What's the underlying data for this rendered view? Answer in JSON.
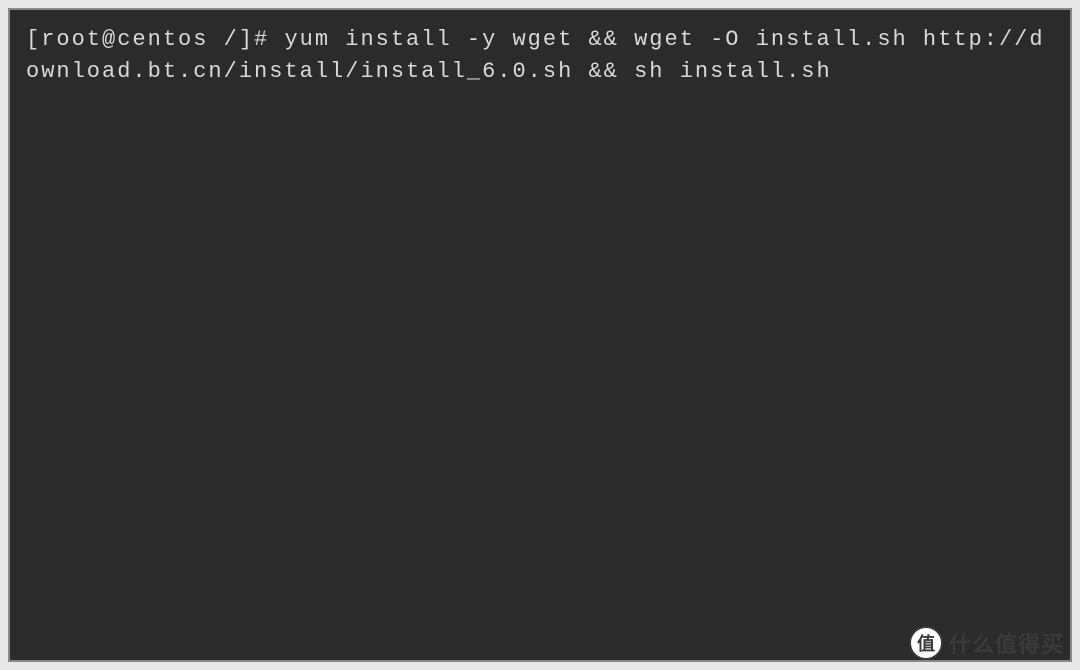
{
  "terminal": {
    "prompt": "[root@centos /]# ",
    "command": "yum install -y wget && wget -O install.sh http://download.bt.cn/install/install_6.0.sh && sh install.sh"
  },
  "watermark": {
    "icon_char": "值",
    "text": "什么值得买"
  }
}
